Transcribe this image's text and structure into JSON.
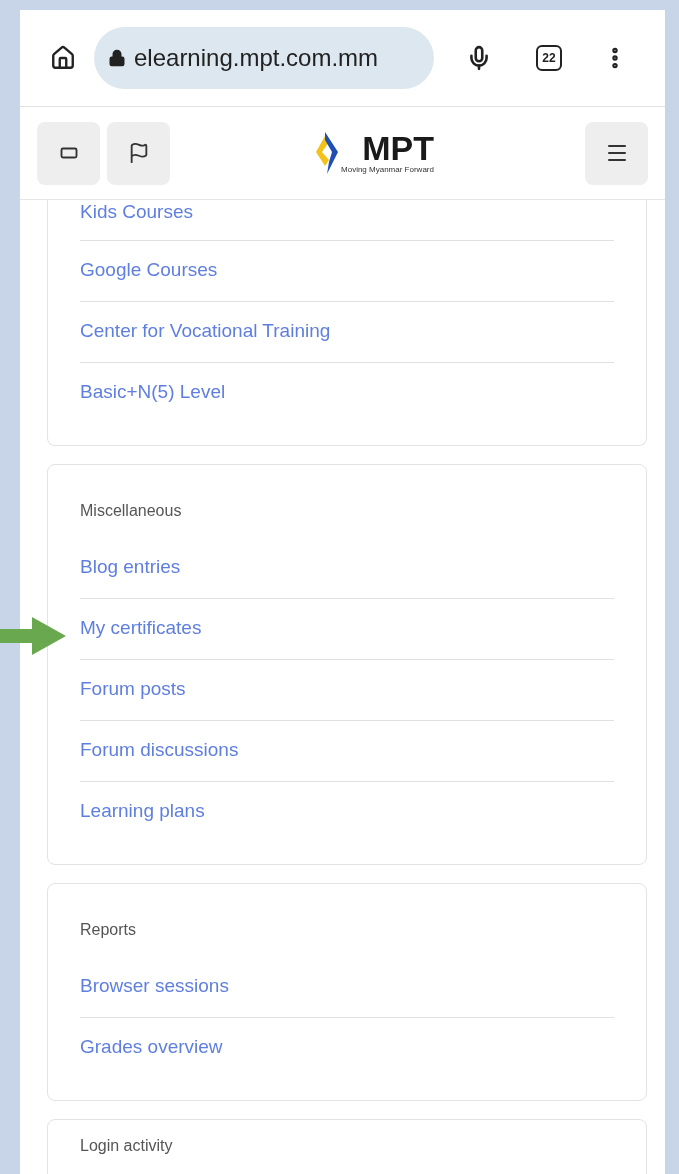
{
  "browser": {
    "url": "elearning.mpt.com.mm",
    "tab_count": "22"
  },
  "site_header": {
    "logo_text": "MPT",
    "tagline": "Moving Myanmar Forward"
  },
  "sections": [
    {
      "items": [
        "Kids Courses",
        "Google Courses",
        "Center for Vocational Training",
        "Basic+N(5) Level"
      ]
    },
    {
      "title": "Miscellaneous",
      "items": [
        "Blog entries",
        "My certificates",
        "Forum posts",
        "Forum discussions",
        "Learning plans"
      ]
    },
    {
      "title": "Reports",
      "items": [
        "Browser sessions",
        "Grades overview"
      ]
    },
    {
      "title": "Login activity"
    }
  ]
}
